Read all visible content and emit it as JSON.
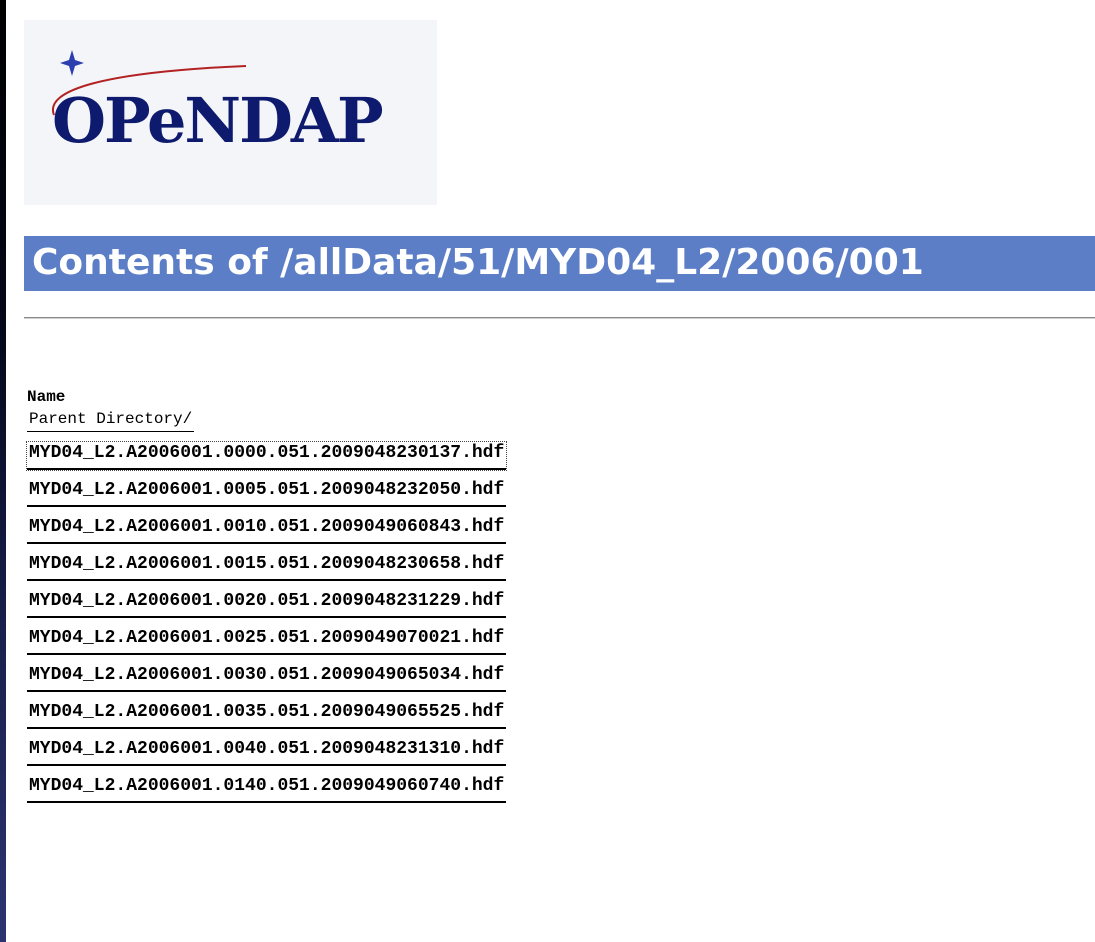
{
  "logo": {
    "text": "OPeNDAP",
    "colors": {
      "text": "#0d1a6e",
      "swoosh": "#b22222",
      "star": "#2b3fb0"
    }
  },
  "title": "Contents of /allData/51/MYD04_L2/2006/001",
  "listing": {
    "column_header": "Name",
    "parent_directory": "Parent Directory/",
    "files": [
      "MYD04_L2.A2006001.0000.051.2009048230137.hdf",
      "MYD04_L2.A2006001.0005.051.2009048232050.hdf",
      "MYD04_L2.A2006001.0010.051.2009049060843.hdf",
      "MYD04_L2.A2006001.0015.051.2009048230658.hdf",
      "MYD04_L2.A2006001.0020.051.2009048231229.hdf",
      "MYD04_L2.A2006001.0025.051.2009049070021.hdf",
      "MYD04_L2.A2006001.0030.051.2009049065034.hdf",
      "MYD04_L2.A2006001.0035.051.2009049065525.hdf",
      "MYD04_L2.A2006001.0040.051.2009048231310.hdf",
      "MYD04_L2.A2006001.0140.051.2009049060740.hdf"
    ]
  },
  "colors": {
    "title_bar": "#5b7ec7",
    "background": "#ffffff",
    "frame": "#000000"
  }
}
